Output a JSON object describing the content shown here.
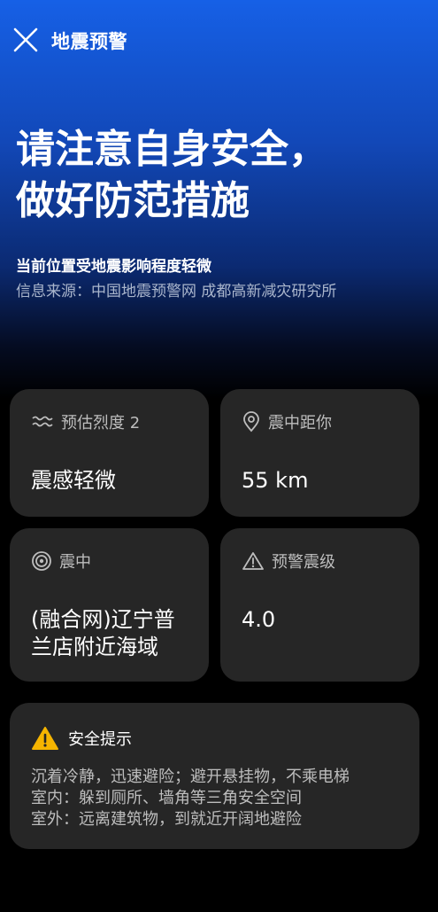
{
  "header": {
    "close_icon": "close-icon",
    "title": "地震预警"
  },
  "alert": {
    "headline_line1": "请注意自身安全，",
    "headline_line2": "做好防范措施",
    "impact": "当前位置受地震影响程度轻微",
    "source": "信息来源：中国地震预警网 成都高新减灾研究所"
  },
  "cards": {
    "intensity": {
      "icon": "waves-icon",
      "label": "预估烈度 2",
      "value": "震感轻微"
    },
    "distance": {
      "icon": "location-pin-icon",
      "label": "震中距你",
      "value": "55 km"
    },
    "epicenter": {
      "icon": "target-icon",
      "label": "震中",
      "value_line1": "(融合网)辽宁普",
      "value_line2": "兰店附近海域"
    },
    "magnitude": {
      "icon": "warning-icon",
      "label": "预警震级",
      "value": "4.0"
    }
  },
  "tips": {
    "icon": "warning-filled-icon",
    "title": "安全提示",
    "lines": [
      "沉着冷静，迅速避险；避开悬挂物，不乘电梯",
      "室内：躲到厕所、墙角等三角安全空间",
      "室外：远离建筑物，到就近开阔地避险"
    ]
  },
  "colors": {
    "gradient_top": "#1660e6",
    "background": "#000000",
    "card": "#262626",
    "warning_yellow": "#f5b400",
    "secondary_text": "#bdbdbd"
  }
}
